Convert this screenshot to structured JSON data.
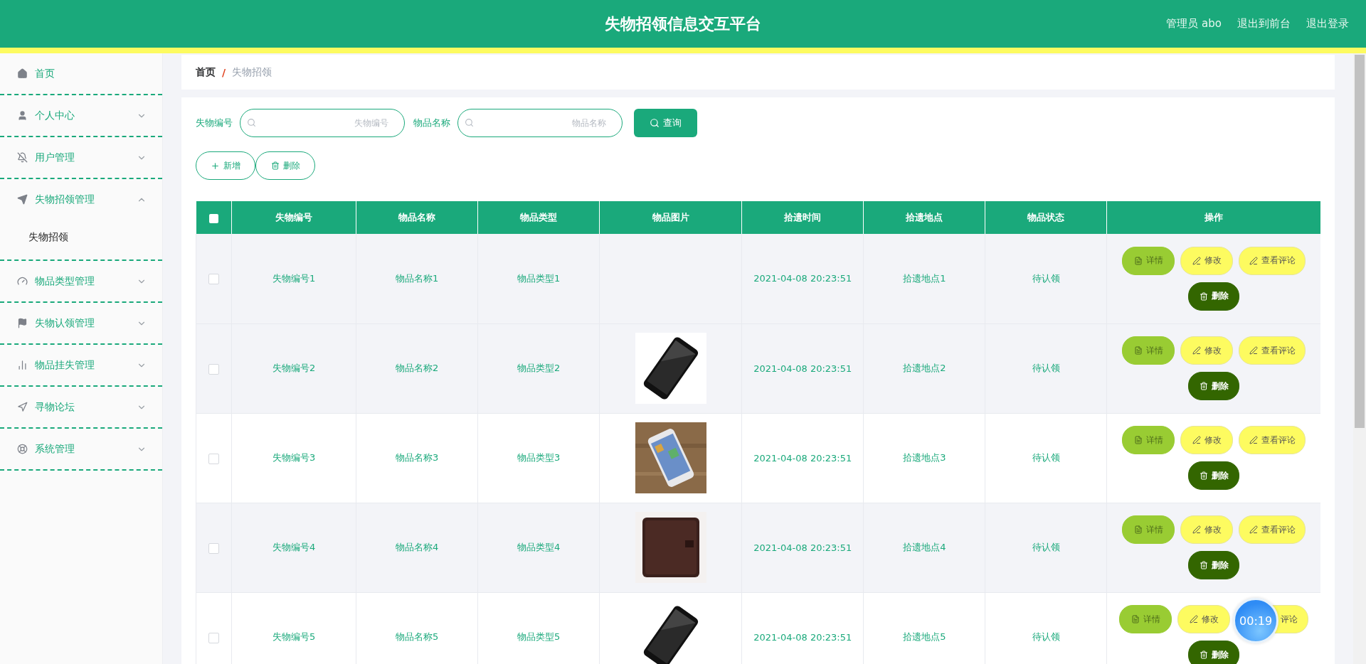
{
  "header": {
    "title": "失物招领信息交互平台",
    "links": [
      "管理员 abo",
      "退出到前台",
      "退出登录"
    ]
  },
  "sidebar": {
    "items": [
      {
        "label": "首页"
      },
      {
        "label": "个人中心",
        "expanded": false
      },
      {
        "label": "用户管理",
        "expanded": false
      },
      {
        "label": "失物招领管理",
        "expanded": true,
        "children": [
          {
            "label": "失物招领",
            "selected": true
          }
        ]
      },
      {
        "label": "物品类型管理",
        "expanded": false
      },
      {
        "label": "失物认领管理",
        "expanded": false
      },
      {
        "label": "物品挂失管理",
        "expanded": false
      },
      {
        "label": "寻物论坛",
        "expanded": false
      },
      {
        "label": "系统管理",
        "expanded": false
      }
    ]
  },
  "breadcrumb": {
    "home": "首页",
    "separator": "/",
    "current": "失物招领"
  },
  "search": {
    "fields": [
      {
        "label": "失物编号",
        "placeholder": "失物编号"
      },
      {
        "label": "物品名称",
        "placeholder": "物品名称"
      }
    ],
    "button": "查询"
  },
  "toolbar": {
    "add": "新增",
    "delete": "删除"
  },
  "table": {
    "all_checked": false,
    "columns": [
      "失物编号",
      "物品名称",
      "物品类型",
      "物品图片",
      "拾遗时间",
      "拾遗地点",
      "物品状态",
      "操作"
    ],
    "rows": [
      {
        "checked": false,
        "hovered": true,
        "cells": [
          "失物编号1",
          "物品名称1",
          "物品类型1",
          "",
          "2021-04-08 20:23:51",
          "拾遗地点1",
          "待认领"
        ],
        "actions": [
          {
            "kind": "detail",
            "label": "详情"
          },
          {
            "kind": "edit",
            "label": "修改"
          },
          {
            "kind": "comment",
            "label": "查看评论"
          },
          {
            "kind": "delete",
            "label": "删除"
          }
        ]
      },
      {
        "checked": false,
        "cells": [
          "失物编号2",
          "物品名称2",
          "物品类型2",
          "",
          "2021-04-08 20:23:51",
          "拾遗地点2",
          "待认领"
        ],
        "photo": {
          "kind": "picture"
        },
        "actions": [
          {
            "kind": "detail",
            "label": "详情"
          },
          {
            "kind": "edit",
            "label": "修改"
          },
          {
            "kind": "comment",
            "label": "查看评论"
          },
          {
            "kind": "delete",
            "label": "删除"
          }
        ]
      },
      {
        "checked": false,
        "cells": [
          "失物编号3",
          "物品名称3",
          "物品类型3",
          "",
          "2021-04-08 20:23:51",
          "拾遗地点3",
          "待认领"
        ],
        "photo": {
          "kind": "picture"
        },
        "actions": [
          {
            "kind": "detail",
            "label": "详情"
          },
          {
            "kind": "edit",
            "label": "修改"
          },
          {
            "kind": "comment",
            "label": "查看评论"
          },
          {
            "kind": "delete",
            "label": "删除"
          }
        ]
      },
      {
        "checked": false,
        "cells": [
          "失物编号4",
          "物品名称4",
          "物品类型4",
          "",
          "2021-04-08 20:23:51",
          "拾遗地点4",
          "待认领"
        ],
        "photo": {
          "kind": "picture"
        },
        "actions": [
          {
            "kind": "detail",
            "label": "详情"
          },
          {
            "kind": "edit",
            "label": "修改"
          },
          {
            "kind": "comment",
            "label": "查看评论"
          },
          {
            "kind": "delete",
            "label": "删除"
          }
        ]
      },
      {
        "checked": false,
        "cells": [
          "失物编号5",
          "物品名称5",
          "物品类型5",
          "",
          "2021-04-08 20:23:51",
          "拾遗地点5",
          "待认领"
        ],
        "photo": {
          "kind": "picture"
        },
        "actions": [
          {
            "kind": "detail",
            "label": "详情"
          },
          {
            "kind": "edit",
            "label": "修改"
          },
          {
            "kind": "comment",
            "label": "评论",
            "covered": true
          },
          {
            "kind": "delete",
            "label": "删除"
          }
        ]
      }
    ]
  },
  "timer": {
    "text": "00:19"
  }
}
